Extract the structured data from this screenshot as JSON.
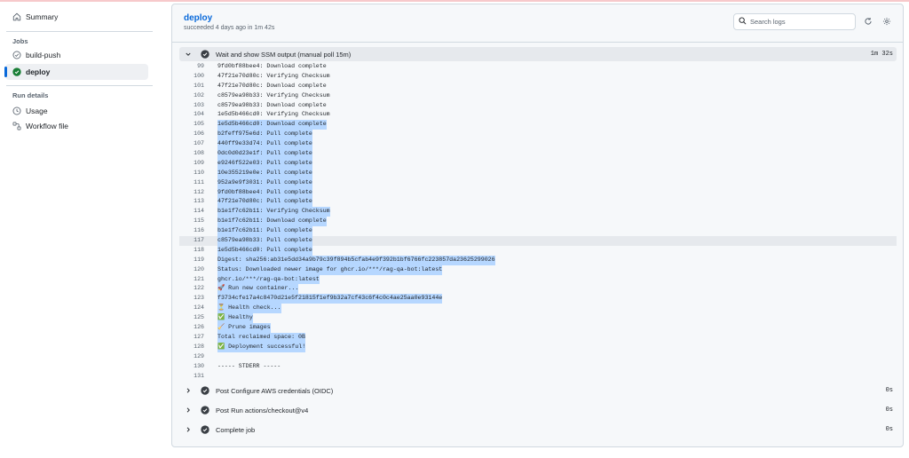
{
  "sidebar": {
    "summary": "Summary",
    "jobs_heading": "Jobs",
    "jobs": [
      {
        "label": "build-push",
        "status": "success"
      },
      {
        "label": "deploy",
        "status": "success-active"
      }
    ],
    "run_details_heading": "Run details",
    "details": [
      {
        "label": "Usage",
        "icon": "clock-icon"
      },
      {
        "label": "Workflow file",
        "icon": "workflow-file-icon"
      }
    ]
  },
  "job": {
    "title": "deploy",
    "subtitle": "succeeded 4 days ago in 1m 42s"
  },
  "search": {
    "placeholder": "Search logs"
  },
  "steps": {
    "open": {
      "name": "Wait and show SSM output (manual poll 15m)",
      "duration": "1m 32s"
    },
    "collapsed": [
      {
        "name": "Post Configure AWS credentials (OIDC)",
        "duration": "0s"
      },
      {
        "name": "Post Run actions/checkout@v4",
        "duration": "0s"
      },
      {
        "name": "Complete job",
        "duration": "0s"
      }
    ]
  },
  "log": [
    {
      "n": "99",
      "t": "9fd0bf88bee4: Download complete",
      "sel": false
    },
    {
      "n": "100",
      "t": "47f21e70d80c: Verifying Checksum",
      "sel": false
    },
    {
      "n": "101",
      "t": "47f21e70d80c: Download complete",
      "sel": false
    },
    {
      "n": "102",
      "t": "c8579ea98b33: Verifying Checksum",
      "sel": false
    },
    {
      "n": "103",
      "t": "c8579ea98b33: Download complete",
      "sel": false
    },
    {
      "n": "104",
      "t": "1e5d5b466cd0: Verifying Checksum",
      "sel": false
    },
    {
      "n": "105",
      "t": "1e5d5b466cd0: Download complete",
      "sel": true
    },
    {
      "n": "106",
      "t": "b2feff975e6d: Pull complete",
      "sel": true
    },
    {
      "n": "107",
      "t": "440ff9e33d74: Pull complete",
      "sel": true
    },
    {
      "n": "108",
      "t": "0dc0d0d23e1f: Pull complete",
      "sel": true
    },
    {
      "n": "109",
      "t": "e9246f522e03: Pull complete",
      "sel": true
    },
    {
      "n": "110",
      "t": "10e355219e0e: Pull complete",
      "sel": true
    },
    {
      "n": "111",
      "t": "952a9e9f3031: Pull complete",
      "sel": true
    },
    {
      "n": "112",
      "t": "9fd0bf88bee4: Pull complete",
      "sel": true
    },
    {
      "n": "113",
      "t": "47f21e70d80c: Pull complete",
      "sel": true
    },
    {
      "n": "114",
      "t": "b1e1f7c62b11: Verifying Checksum",
      "sel": true
    },
    {
      "n": "115",
      "t": "b1e1f7c62b11: Download complete",
      "sel": true
    },
    {
      "n": "116",
      "t": "b1e1f7c62b11: Pull complete",
      "sel": true
    },
    {
      "n": "117",
      "t": "c8579ea98b33: Pull complete",
      "sel": true,
      "cur": true
    },
    {
      "n": "118",
      "t": "1e5d5b466cd0: Pull complete",
      "sel": true
    },
    {
      "n": "119",
      "t": "Digest: sha256:ab31e5dd34a9b79c39f894b5cfab4e9f392b1bf6766fc223857da23625299026",
      "sel": true
    },
    {
      "n": "120",
      "t": "Status: Downloaded newer image for ghcr.io/***/rag-qa-bot:latest",
      "sel": true
    },
    {
      "n": "121",
      "t": "ghcr.io/***/rag-qa-bot:latest",
      "sel": true
    },
    {
      "n": "122",
      "t": "🚀 Run new container...",
      "sel": true
    },
    {
      "n": "123",
      "t": "f3734cfe17a4c8470d21e5f21815f1ef9b32a7cf43c6f4c0c4ae25aa0e93144e",
      "sel": true
    },
    {
      "n": "124",
      "t": "⏳ Health check...",
      "sel": true
    },
    {
      "n": "125",
      "t": "✅ Healthy",
      "sel": true
    },
    {
      "n": "126",
      "t": "🧹 Prune images",
      "sel": true
    },
    {
      "n": "127",
      "t": "Total reclaimed space: 0B",
      "sel": true
    },
    {
      "n": "128",
      "t": "✅ Deployment successful!",
      "sel": true
    },
    {
      "n": "129",
      "t": "",
      "sel": false
    },
    {
      "n": "130",
      "t": "----- STDERR -----",
      "sel": false
    },
    {
      "n": "131",
      "t": "",
      "sel": false
    }
  ],
  "colors": {
    "accent": "#0969da",
    "success": "#1a7f37",
    "step_check": "#3a3f45",
    "selection": "#b6d7ff"
  }
}
